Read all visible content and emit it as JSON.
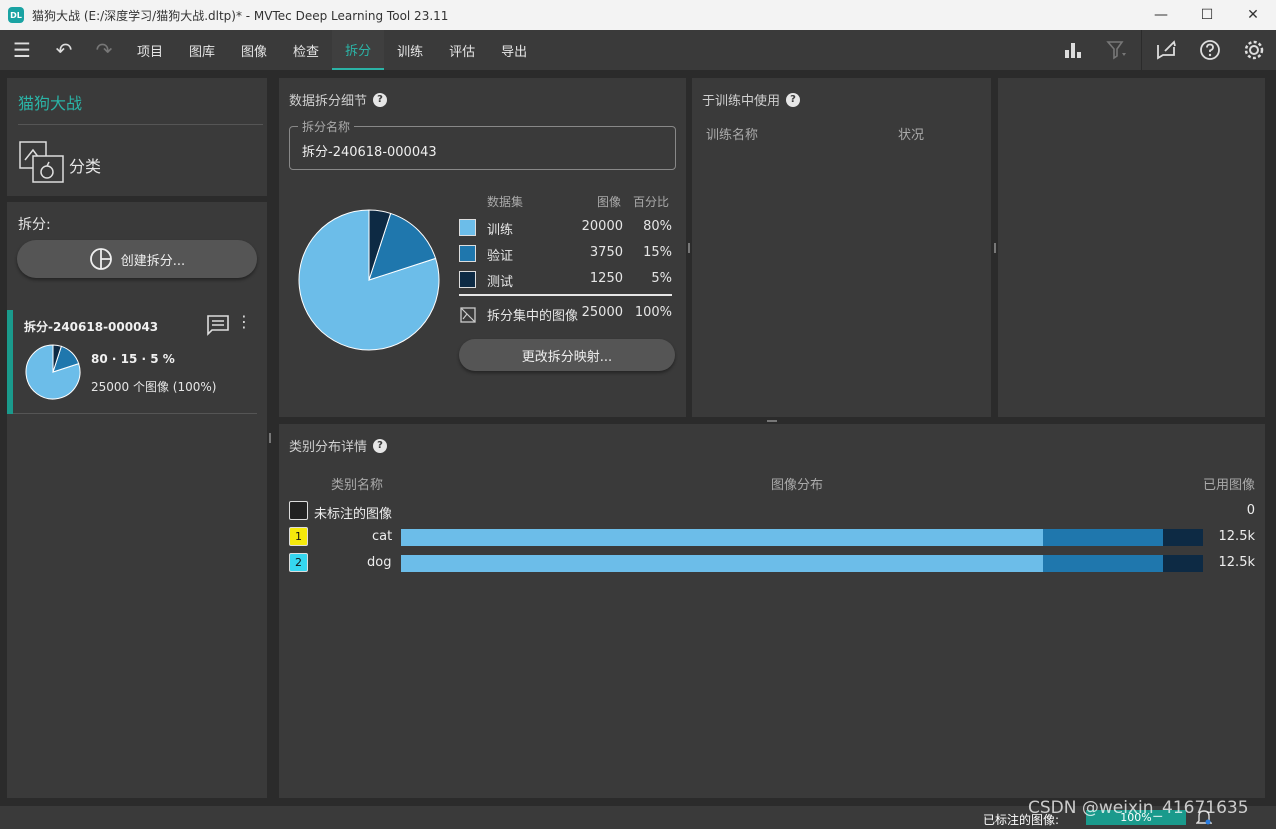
{
  "window": {
    "title": "猫狗大战 (E:/深度学习/猫狗大战.dltp)* - MVTec Deep Learning Tool 23.11",
    "logo": "DL",
    "minimize": "—",
    "maximize": "☐",
    "close": "✕"
  },
  "menu": {
    "items": [
      "项目",
      "图库",
      "图像",
      "检查",
      "拆分",
      "训练",
      "评估",
      "导出"
    ],
    "active": "拆分",
    "accent": "#2bb3a6"
  },
  "project": {
    "name": "猫狗大战",
    "type": "分类"
  },
  "splits": {
    "heading": "拆分:",
    "create_button": "创建拆分...",
    "item": {
      "name": "拆分-240618-000043",
      "ratio": "80 · 15 · 5 %",
      "count": "25000 个图像 (100%)"
    }
  },
  "details": {
    "title": "数据拆分细节",
    "help": "?",
    "name_legend": "拆分名称",
    "name_value": "拆分-240618-000043",
    "table_headers": {
      "dataset": "数据集",
      "images": "图像",
      "percent": "百分比"
    },
    "rows": [
      {
        "name": "训练",
        "images": "20000",
        "percent": "80%",
        "color": "#6cbde9"
      },
      {
        "name": "验证",
        "images": "3750",
        "percent": "15%",
        "color": "#1f77ad"
      },
      {
        "name": "测试",
        "images": "1250",
        "percent": "5%",
        "color": "#0d2a44"
      }
    ],
    "total": {
      "label": "拆分集中的图像",
      "images": "25000",
      "percent": "100%"
    },
    "change_button": "更改拆分映射..."
  },
  "training": {
    "title": "于训练中使用",
    "help": "?",
    "col_name": "训练名称",
    "col_status": "状况"
  },
  "distribution": {
    "title": "类别分布详情",
    "help": "?",
    "col_class": "类别名称",
    "col_distribution": "图像分布",
    "col_used": "已用图像",
    "unlabeled": {
      "name": "未标注的图像",
      "used": "0"
    },
    "classes": [
      {
        "id": "1",
        "name": "cat",
        "used": "12.5k",
        "badge_color": "#f5e90c",
        "fractions": [
          0.8,
          0.15,
          0.05
        ]
      },
      {
        "id": "2",
        "name": "dog",
        "used": "12.5k",
        "badge_color": "#35d6f0",
        "fractions": [
          0.8,
          0.15,
          0.05
        ]
      }
    ]
  },
  "chart_data": {
    "type": "pie",
    "categories": [
      "训练",
      "验证",
      "测试"
    ],
    "values": [
      20000,
      3750,
      1250
    ],
    "colors": [
      "#6cbde9",
      "#1f77ad",
      "#0d2a44"
    ]
  },
  "status": {
    "label": "已标注的图像:",
    "progress_text": "100%",
    "progress_value": 1.0
  },
  "watermark": "CSDN @weixin_41671635"
}
